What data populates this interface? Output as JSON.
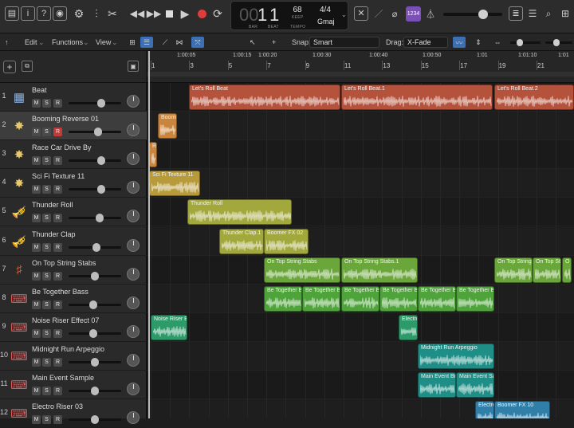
{
  "transport": {
    "bar": "1",
    "beat": "1",
    "bar_dim": "00",
    "bar_caption": "BAR",
    "beat_caption": "BEAT",
    "tempo": "68",
    "tempo_mode": "KEEP",
    "tempo_caption": "TEMPO",
    "time_signature": "4/4",
    "key": "Gmaj",
    "count_in": "1234"
  },
  "toolbar": {
    "edit": "Edit",
    "functions": "Functions",
    "view": "View",
    "snap_label": "Snap:",
    "snap_value": "Smart",
    "drag_label": "Drag:",
    "drag_value": "X-Fade"
  },
  "ruler": {
    "bars": [
      "1",
      "3",
      "5",
      "7",
      "9",
      "11",
      "13",
      "15",
      "17",
      "19",
      "21"
    ],
    "times": [
      "1:00:05",
      "1:00:15",
      "1:00:20",
      "1:00:30",
      "1:00:40",
      "1:00:50",
      "1:01",
      "1:01:10",
      "1:01"
    ]
  },
  "tracks": [
    {
      "num": "1",
      "name": "Beat",
      "icon": "drum-machine-icon",
      "rec": false
    },
    {
      "num": "2",
      "name": "Booming Reverse 01",
      "icon": "fx-burst-icon",
      "rec": true
    },
    {
      "num": "3",
      "name": "Race Car Drive By",
      "icon": "fx-burst-icon",
      "rec": false
    },
    {
      "num": "4",
      "name": "Sci Fi Texture 11",
      "icon": "fx-burst-icon",
      "rec": false
    },
    {
      "num": "5",
      "name": "Thunder Roll",
      "icon": "trumpet-icon",
      "rec": false
    },
    {
      "num": "6",
      "name": "Thunder Clap",
      "icon": "trumpet-icon",
      "rec": false
    },
    {
      "num": "7",
      "name": "On Top String Stabs",
      "icon": "strings-icon",
      "rec": false
    },
    {
      "num": "8",
      "name": "Be Together Bass",
      "icon": "keyboard-icon",
      "rec": false
    },
    {
      "num": "9",
      "name": "Noise Riser Effect 07",
      "icon": "keyboard-icon",
      "rec": false
    },
    {
      "num": "10",
      "name": "Midnight Run Arpeggio",
      "icon": "keyboard-icon",
      "rec": false
    },
    {
      "num": "11",
      "name": "Main Event Sample",
      "icon": "keyboard-icon",
      "rec": false
    },
    {
      "num": "12",
      "name": "Electro Riser 03",
      "icon": "keyboard-icon",
      "rec": false
    }
  ],
  "regions": {
    "t1": [
      "Let's Roll Beat",
      "Let's Roll Beat.1",
      "Let's Roll Beat.2"
    ],
    "t2": [
      "Boomi"
    ],
    "t3": [
      "R"
    ],
    "t4": [
      "Sci Fi Texture 11"
    ],
    "t5": [
      "Thunder Roll"
    ],
    "t6": [
      "Thunder Clap.1",
      "Boomer FX 02"
    ],
    "t7": [
      "On Top String Stabs",
      "On Top String Stabs.1",
      "On Top String",
      "On Top Str",
      "O"
    ],
    "t8": [
      "Be Together B",
      "Be Together B",
      "Be Together B",
      "Be Together B",
      "Be Together B",
      "Be Together B"
    ],
    "t9": [
      "Noise Riser Ef",
      "Electro"
    ],
    "t10": [
      "Midnight Run Arpeggio"
    ],
    "t11": [
      "Main Event Bra",
      "Main Event Sa"
    ],
    "t12": [
      "Electro",
      "Boomer FX 10"
    ]
  },
  "colors": {
    "drums": "#b5523b",
    "orange": "#c9853e",
    "olive": "#b79a3a",
    "yellow_green": "#a3a83c",
    "green": "#6aa63a",
    "bright_green": "#4ea33a",
    "teal": "#2d9a6a",
    "cyan": "#1f8e86",
    "blue": "#2f7fa8"
  }
}
